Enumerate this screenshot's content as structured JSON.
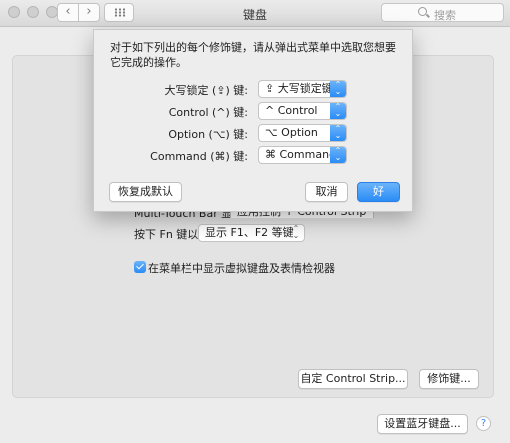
{
  "window": {
    "title": "键盘"
  },
  "toolbar": {
    "back": "‹",
    "forward": "›",
    "search_placeholder": "搜索"
  },
  "background": {
    "touchbar_label": "Multi-Touch Bar 显示",
    "touchbar_value": "应用控制 + Control Strip",
    "fn_label": "按下 Fn 键以",
    "fn_value": "显示 F1、F2 等键",
    "checkbox_label": "在菜单栏中显示虚拟键盘及表情检视器",
    "checkbox_checked": true,
    "customize_control_strip": "自定 Control Strip...",
    "modifier_keys": "修饰键...",
    "setup_bluetooth": "设置蓝牙键盘...",
    "help": "?"
  },
  "sheet": {
    "message": "对于如下列出的每个修饰键，请从弹出式菜单中选取您想要它完成的操作。",
    "rows": [
      {
        "label": "大写锁定 (⇪) 键:",
        "value": "⇪ 大写锁定键"
      },
      {
        "label": "Control (^) 键:",
        "value": "^ Control"
      },
      {
        "label": "Option (⌥) 键:",
        "value": "⌥ Option"
      },
      {
        "label": "Command (⌘) 键:",
        "value": "⌘ Command"
      }
    ],
    "restore_defaults": "恢复成默认",
    "cancel": "取消",
    "ok": "好"
  },
  "colors": {
    "accent": "#2a8cf5",
    "window_bg": "#ececec"
  }
}
